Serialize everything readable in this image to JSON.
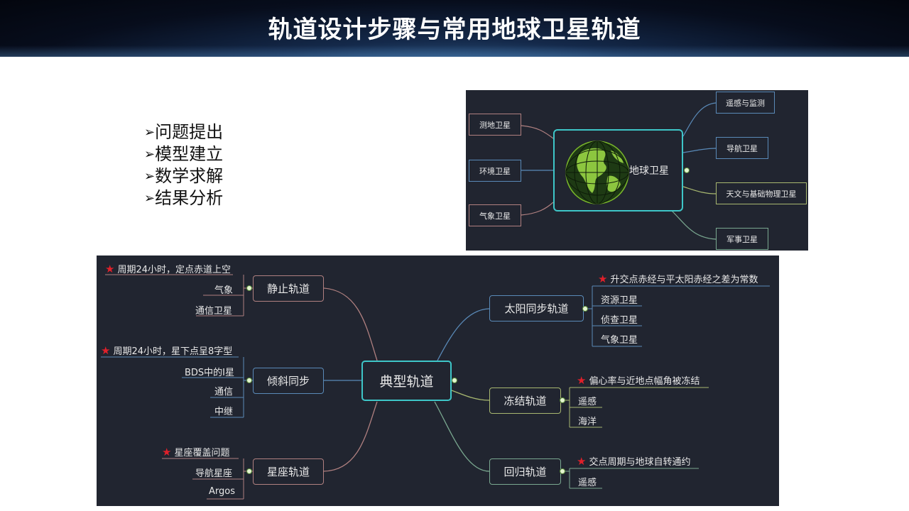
{
  "page": {
    "title": "轨道设计步骤与常用地球卫星轨道"
  },
  "steps": [
    "问题提出",
    "模型建立",
    "数学求解",
    "结果分析"
  ],
  "steps_arrow": "➢",
  "earth_map": {
    "center": "地球卫星",
    "left": [
      "测地卫星",
      "环境卫星",
      "气象卫星"
    ],
    "right": [
      "遥感与监测",
      "导航卫星",
      "天文与基础物理卫星",
      "军事卫星"
    ]
  },
  "orbit_map": {
    "center": "典型轨道",
    "star_glyph": "★",
    "static": {
      "label": "静止轨道",
      "note": "周期24小时，定点赤道上空",
      "items": [
        "气象",
        "通信卫星"
      ]
    },
    "incline": {
      "label": "倾斜同步",
      "note": "周期24小时，星下点呈8字型",
      "items": [
        "BDS中的I星",
        "通信",
        "中继"
      ]
    },
    "constellation": {
      "label": "星座轨道",
      "note": "星座覆盖问题",
      "items": [
        "导航星座",
        "Argos"
      ]
    },
    "sunsync": {
      "label": "太阳同步轨道",
      "note": "升交点赤经与平太阳赤经之差为常数",
      "items": [
        "资源卫星",
        "侦查卫星",
        "气象卫星"
      ]
    },
    "frozen": {
      "label": "冻结轨道",
      "note": "偏心率与近地点幅角被冻结",
      "items": [
        "遥感",
        "海洋"
      ]
    },
    "recursive": {
      "label": "回归轨道",
      "note": "交点周期与地球自转通约",
      "items": [
        "遥感"
      ]
    }
  },
  "colors": {
    "panel_bg": "#212530",
    "center_border": "#3ec6c8",
    "star": "#e0202a"
  }
}
